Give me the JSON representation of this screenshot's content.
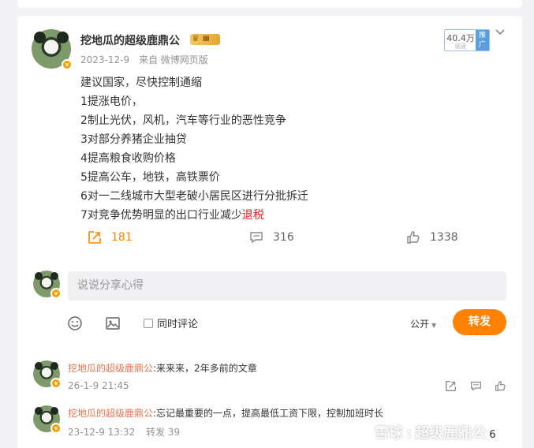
{
  "post": {
    "author": "挖地瓜的超级鹿鼎公",
    "vip_level": "Ⅲ",
    "date": "2023-12-9",
    "source": "来自 微博网页版",
    "views": "40.4万",
    "views_label": "阅读",
    "promote_label": "推广",
    "body_lines": [
      "建议国家，尽快控制通缩",
      "1提涨电价，",
      "2制止光伏，风机，汽车等行业的恶性竞争",
      "3对部分养猪企业抽贷",
      "4提高粮食收购价格",
      "5提高公车，地铁，高铁票价",
      "6对一二线城市大型老破小居民区进行分批拆迁"
    ],
    "last_line_prefix": "7对竞争优势明显的出口行业减少",
    "last_line_link": "退税",
    "share_count": "181",
    "comment_count": "316",
    "like_count": "1338"
  },
  "composer": {
    "placeholder": "说说分享心得",
    "checkbox_label": "同时评论",
    "visibility": "公开",
    "submit_label": "转发"
  },
  "comments": [
    {
      "author": "挖地瓜的超级鹿鼎公",
      "text": ":来来来，2年多前的文章",
      "date": "26-1-9 21:45",
      "extra": ""
    },
    {
      "author": "挖地瓜的超级鹿鼎公",
      "text": ":忘记最重要的一点，提高最低工资下限，控制加班时长",
      "date": "23-12-9 13:32",
      "extra": "转发 39"
    }
  ],
  "watermark": {
    "brand": "雪球",
    "author": "超级鹿鼎公",
    "trailing_count": "6"
  },
  "colors": {
    "accent": "#ff8200",
    "link_red": "#e02020",
    "comment_name": "#eb7350"
  }
}
